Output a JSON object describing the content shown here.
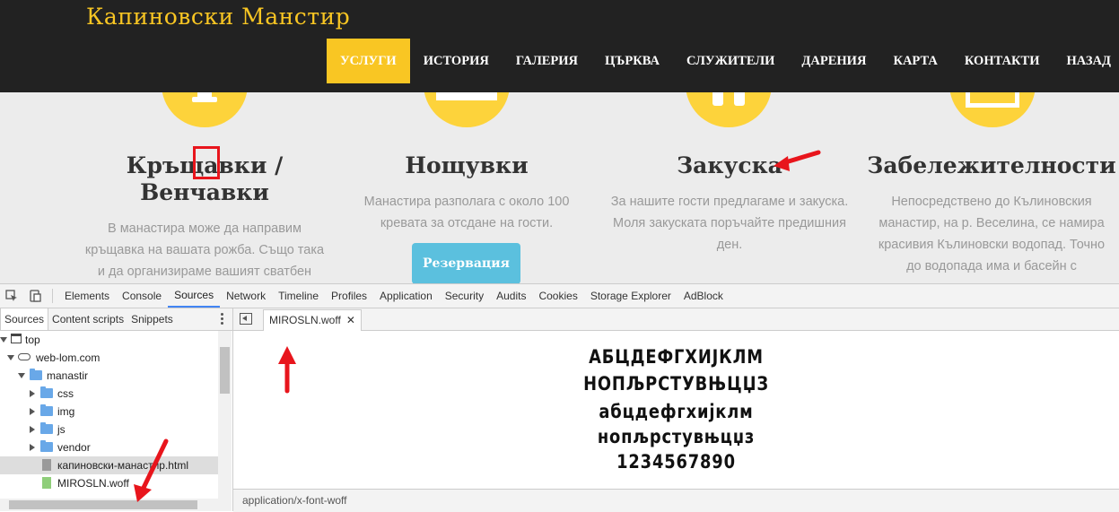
{
  "site": {
    "brand": "Капиновски Манстир",
    "nav": [
      "УСЛУГИ",
      "ИСТОРИЯ",
      "ГАЛЕРИЯ",
      "ЦЪРКВА",
      "СЛУЖИТЕЛИ",
      "ДАРЕНИЯ",
      "КАРТА",
      "КОНТАКТИ",
      "НАЗАД"
    ],
    "active_nav": "УСЛУГИ",
    "features": [
      {
        "title_line1": "Кръщавки /",
        "title_line2": "Венчавки",
        "text": [
          "В манастира може да направим",
          "кръщавка на вашата рожба. Също така",
          "и да организираме вашият сватбен"
        ]
      },
      {
        "title_line1": "Нощувки",
        "text": [
          "Манастира разполага с около 100",
          "кревата за отсдане на гости."
        ],
        "button": "Резервация"
      },
      {
        "title_line1": "Закуска",
        "text": [
          "За нашите гости предлагаме и закуска.",
          "Моля закуската поръчайте предишния",
          "ден."
        ]
      },
      {
        "title_line1": "Забележителности",
        "text": [
          "Непосредствено до Кълиновския",
          "манастир, на р. Веселина, се намира",
          "красивия Кълиновски водопад. Точно",
          "до водопада има и басейн с"
        ]
      }
    ],
    "colors": {
      "accent": "#f9c623",
      "header_bg": "#222222",
      "button": "#5bc0de",
      "annotation": "#e8151c"
    }
  },
  "devtools": {
    "tabs": [
      "Elements",
      "Console",
      "Sources",
      "Network",
      "Timeline",
      "Profiles",
      "Application",
      "Security",
      "Audits",
      "Cookies",
      "Storage Explorer",
      "AdBlock"
    ],
    "active_tab": "Sources",
    "navigator_tabs": [
      "Sources",
      "Content scripts",
      "Snippets"
    ],
    "tree": [
      {
        "label": "top",
        "icon": "window-icon"
      },
      {
        "label": "web-lom.com",
        "icon": "cloud-icon"
      },
      {
        "label": "manastir",
        "icon": "folder-icon"
      },
      {
        "label": "css",
        "icon": "folder-icon"
      },
      {
        "label": "img",
        "icon": "folder-icon"
      },
      {
        "label": "js",
        "icon": "folder-icon"
      },
      {
        "label": "vendor",
        "icon": "folder-icon"
      },
      {
        "label": "капиновски-манастир.html",
        "icon": "file-icon"
      },
      {
        "label": "MIROSLN.woff",
        "icon": "font-file-icon"
      }
    ],
    "open_file": "MIROSLN.woff",
    "close_glyph": "✕",
    "font_preview": [
      "АБЦДЕФГХИЈКЛМ",
      "НОПЉРСТУВЊЦЏЗ",
      "абцдефгхијклм",
      "нопљрстувњцџз",
      "1234567890"
    ],
    "mime_type": "application/x-font-woff"
  }
}
